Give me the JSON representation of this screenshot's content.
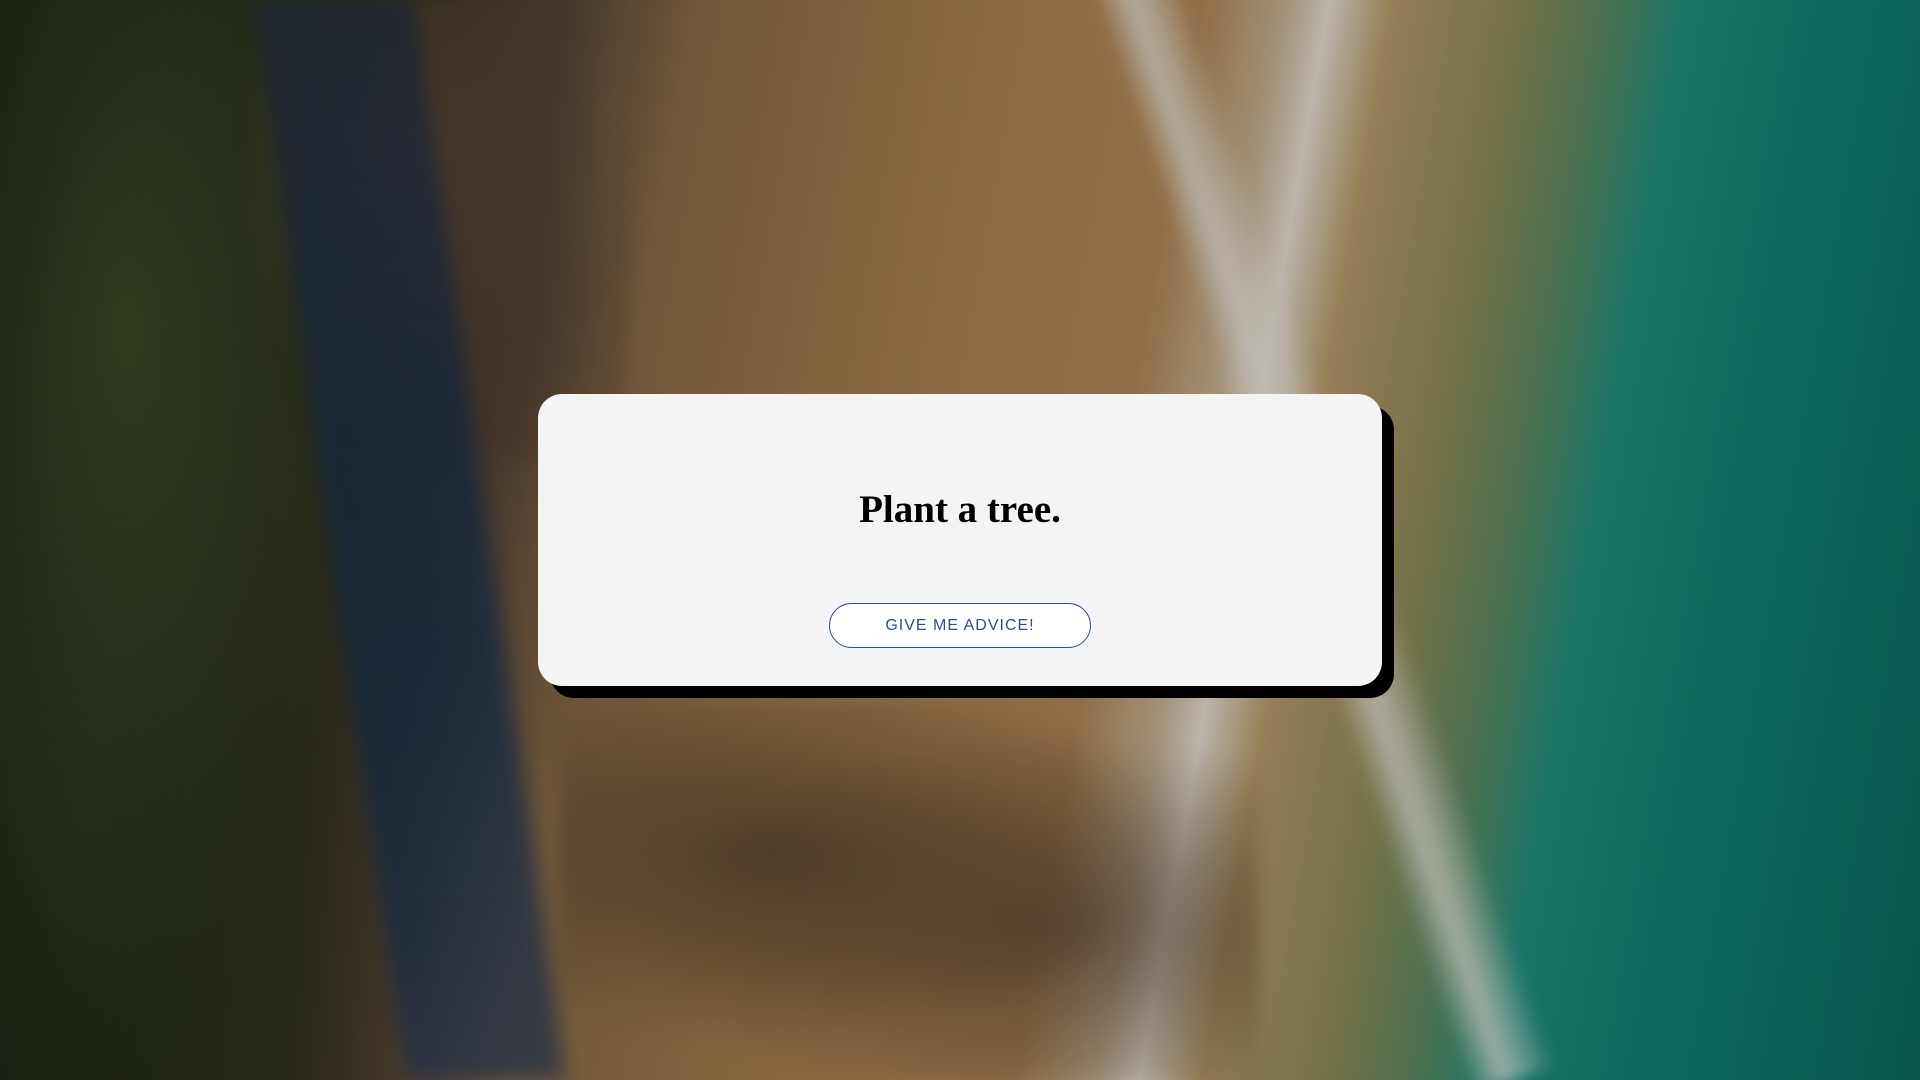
{
  "advice": {
    "text": "Plant a tree.",
    "button_label": "GIVE ME ADVICE!"
  },
  "background": {
    "image": "aerial-beach-photo"
  }
}
